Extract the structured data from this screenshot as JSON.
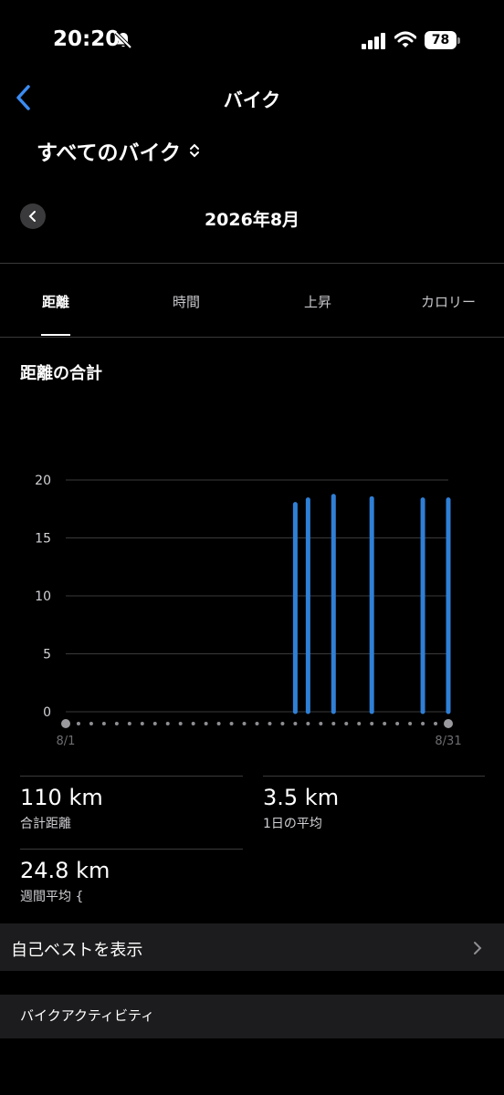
{
  "status": {
    "time": "20:20",
    "battery": "78"
  },
  "nav": {
    "title": "バイク"
  },
  "selector": {
    "label": "すべてのバイク"
  },
  "month": {
    "label": "2026年8月"
  },
  "tabs": [
    {
      "label": "距離"
    },
    {
      "label": "時間"
    },
    {
      "label": "上昇"
    },
    {
      "label": "カロリー"
    }
  ],
  "section": {
    "title": "距離の合計"
  },
  "colors": {
    "accent": "#2f7fd6",
    "grid": "#3a3a3c",
    "dot": "#8e8e93"
  },
  "icons": [
    "bell-slash-icon",
    "signal-icon",
    "wifi-icon",
    "battery-icon",
    "back-chevron-icon",
    "up-down-chevron-icon",
    "prev-chevron-icon",
    "chevron-right-icon"
  ],
  "chart_data": {
    "type": "bar",
    "x_start_label": "8/1",
    "x_end_label": "8/31",
    "days": 31,
    "yticks": [
      0,
      5,
      10,
      15,
      20
    ],
    "ylim": [
      0,
      20
    ],
    "grid": true,
    "bars": [
      {
        "day": 19,
        "value": 17.9
      },
      {
        "day": 20,
        "value": 18.3
      },
      {
        "day": 22,
        "value": 18.6
      },
      {
        "day": 25,
        "value": 18.4
      },
      {
        "day": 29,
        "value": 18.3
      },
      {
        "day": 31,
        "value": 18.3
      }
    ]
  },
  "stats": {
    "total_distance": {
      "value": "110 km",
      "label": "合計距離"
    },
    "daily_avg": {
      "value": "3.5 km",
      "label": "1日の平均"
    },
    "weekly_avg": {
      "value": "24.8 km",
      "label": "週間平均 {"
    }
  },
  "personal_best": {
    "label": "自己ベストを表示"
  },
  "activity": {
    "label": "バイクアクティビティ"
  }
}
